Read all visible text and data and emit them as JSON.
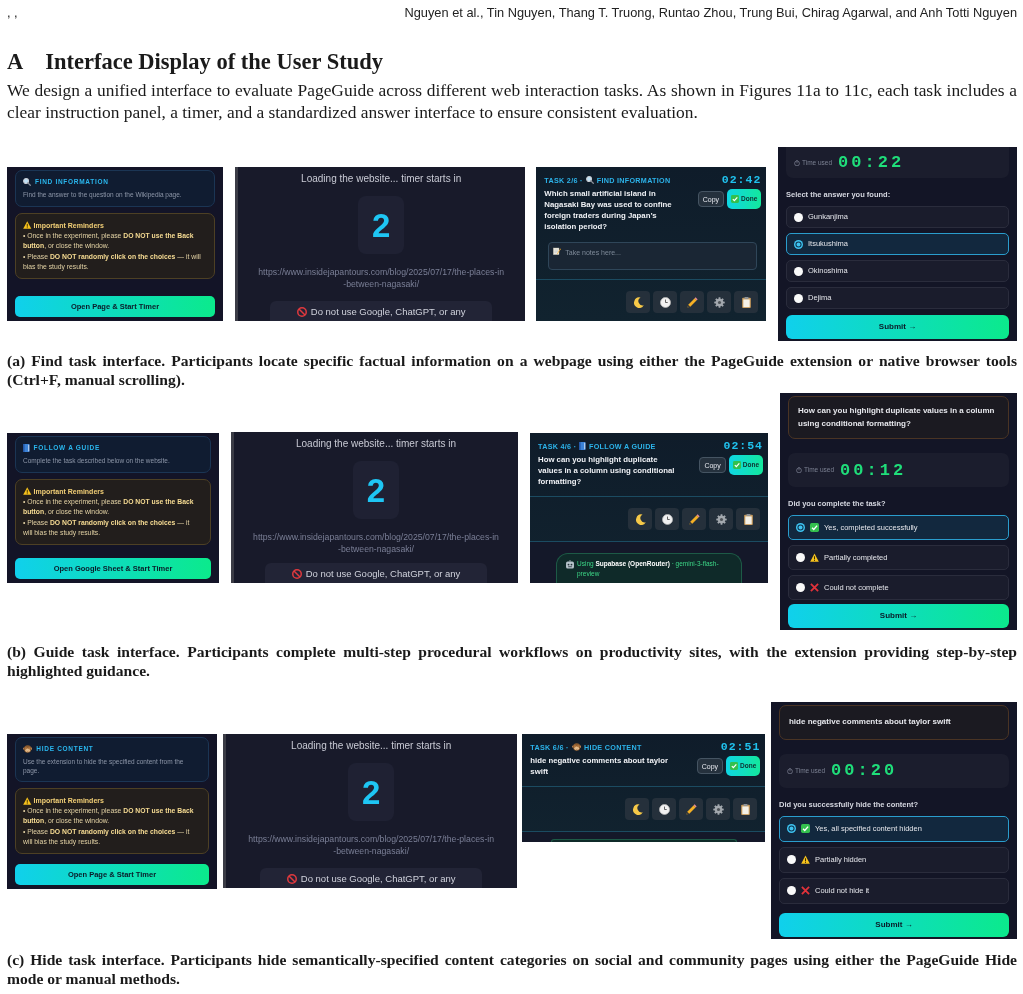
{
  "running_head": {
    "left": ", ,",
    "authors": "Nguyen et al., Tin Nguyen, Thang T. Truong, Runtao Zhou, Trung Bui, Chirag Agarwal, and Anh Totti Nguyen"
  },
  "section": {
    "number": "A",
    "title": "Interface Display of the User Study"
  },
  "intro": "We design a unified interface to evaluate PageGuide across different web interaction tasks. As shown in Figures 11a to 11c, each task includes a clear instruction panel, a timer, and a standardized answer interface to ensure consistent evaluation.",
  "figures": [
    {
      "kind": "find",
      "start_screen": {
        "task_label": "FIND INFORMATION",
        "description": "Find the answer to the question on the Wikipedia page.",
        "reminders_title": "Important Reminders",
        "reminders": [
          "• Once in the experiment, please **DO NOT use the Back button**, or close the window.",
          "• Please **DO NOT randomly click on the choices** — it will bias the study results."
        ],
        "button": "Open Page & Start Timer"
      },
      "loading_screen": {
        "message": "Loading the website... timer starts in",
        "countdown": "2",
        "url": "https://www.insidejapantours.com/blog/2025/07/17/the-places-in-between-nagasaki/",
        "warning": "Do not use Google, ChatGPT, or any"
      },
      "extension_panel": {
        "task_number": "TASK 2/6 ·",
        "task_label": "FIND INFORMATION",
        "timer": "02:42",
        "question": "Which small artificial island in Nagasaki Bay was used to confine foreign traders during Japan’s isolation period?",
        "copy_button": "Copy",
        "done_button": "Done",
        "notes_placeholder": "Take notes here..."
      },
      "answer_panel": {
        "time_label": "Time used",
        "time": "00:22",
        "prompt": "Select the answer you found:",
        "options": [
          {
            "label": "Gunkanjima",
            "kind": "plain",
            "selected": false
          },
          {
            "label": "Itsukushima",
            "kind": "plain",
            "selected": true
          },
          {
            "label": "Okinoshima",
            "kind": "plain",
            "selected": false
          },
          {
            "label": "Dejima",
            "kind": "plain",
            "selected": false
          }
        ],
        "submit": "Submit →"
      },
      "caption": "(a) Find task interface. Participants locate specific factual information on a webpage using either the PageGuide extension or native browser tools (Ctrl+F, manual scrolling)."
    },
    {
      "kind": "guide",
      "start_screen": {
        "task_label": "FOLLOW A GUIDE",
        "description": "Complete the task described below on the website.",
        "reminders_title": "Important Reminders",
        "reminders": [
          "• Once in the experiment, please **DO NOT use the Back button**, or close the window.",
          "• Please **DO NOT randomly click on the choices** — it will bias the study results."
        ],
        "button": "Open Google Sheet & Start Timer"
      },
      "loading_screen": {
        "message": "Loading the website... timer starts in",
        "countdown": "2",
        "url": "https://www.insidejapantours.com/blog/2025/07/17/the-places-in-between-nagasaki/",
        "warning": "Do not use Google, ChatGPT, or any"
      },
      "extension_panel": {
        "task_number": "TASK 4/6 ·",
        "task_label": "FOLLOW A GUIDE",
        "timer": "02:54",
        "question": "How can you highlight duplicate values in a column using conditional formatting?",
        "copy_button": "Copy",
        "done_button": "Done",
        "status_badge": "Using **Supabase (OpenRouter)** · gemini-3-flash-preview"
      },
      "answer_panel": {
        "question": "How can you highlight duplicate values in a column using conditional formatting?",
        "time_label": "Time used",
        "time": "00:12",
        "prompt": "Did you complete the task?",
        "options": [
          {
            "label": "Yes, completed successfully",
            "kind": "yes",
            "selected": true
          },
          {
            "label": "Partially completed",
            "kind": "partial",
            "selected": false
          },
          {
            "label": "Could not complete",
            "kind": "no",
            "selected": false
          }
        ],
        "submit": "Submit →"
      },
      "caption": "(b) Guide task interface. Participants complete multi-step procedural workflows on productivity sites, with the extension providing step-by-step highlighted guidance."
    },
    {
      "kind": "hide",
      "start_screen": {
        "task_label": "HIDE CONTENT",
        "description": "Use the extension to hide the specified content from the page.",
        "reminders_title": "Important Reminders",
        "reminders": [
          "• Once in the experiment, please **DO NOT use the Back button**, or close the window.",
          "• Please **DO NOT randomly click on the choices** — it will bias the study results."
        ],
        "button": "Open Page & Start Timer"
      },
      "loading_screen": {
        "message": "Loading the website... timer starts in",
        "countdown": "2",
        "url": "https://www.insidejapantours.com/blog/2025/07/17/the-places-in-between-nagasaki/",
        "warning": "Do not use Google, ChatGPT, or any"
      },
      "extension_panel": {
        "task_number": "TASK 6/6 ·",
        "task_label": "HIDE CONTENT",
        "timer": "02:51",
        "question": "hide negative comments about taylor swift",
        "copy_button": "Copy",
        "done_button": "Done",
        "status_badge_cut_off": true
      },
      "answer_panel": {
        "question": "hide negative comments about taylor swift",
        "time_label": "Time used",
        "time": "00:20",
        "prompt": "Did you successfully hide the content?",
        "options": [
          {
            "label": "Yes, all specified content hidden",
            "kind": "yes",
            "selected": true
          },
          {
            "label": "Partially hidden",
            "kind": "partial",
            "selected": false
          },
          {
            "label": "Could not hide it",
            "kind": "no",
            "selected": false
          }
        ],
        "submit": "Submit →"
      },
      "caption": "(c) Hide task interface. Participants hide semantically-specified content categories on social and community pages using either the PageGuide Hide mode or manual methods."
    }
  ]
}
